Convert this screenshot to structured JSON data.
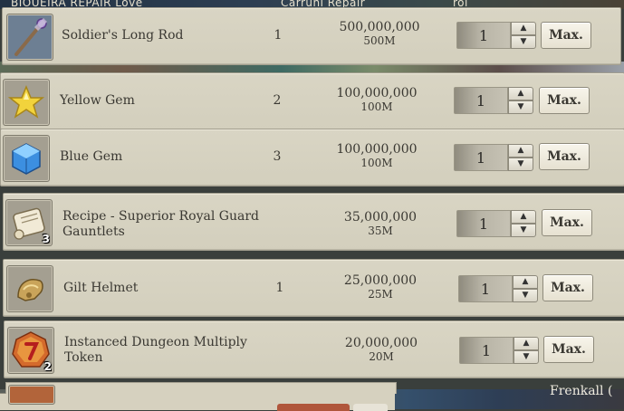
{
  "background": {
    "top_labels": [
      "BIOUEIRA REPAIR Love",
      "Carruni Repair",
      "roi"
    ],
    "side_name": "Frenkall ("
  },
  "max_label": "Max.",
  "items": [
    {
      "name": "Soldier's Long Rod",
      "count": "1",
      "price": "500,000,000",
      "price_short": "500M",
      "quantity": "1",
      "icon": "rod-icon",
      "badge": ""
    },
    {
      "name": "Yellow Gem",
      "count": "2",
      "price": "100,000,000",
      "price_short": "100M",
      "quantity": "1",
      "icon": "yellow-gem-icon",
      "badge": ""
    },
    {
      "name": "Blue Gem",
      "count": "3",
      "price": "100,000,000",
      "price_short": "100M",
      "quantity": "1",
      "icon": "blue-gem-icon",
      "badge": ""
    },
    {
      "name": "Recipe - Superior Royal Guard Gauntlets",
      "count": "",
      "price": "35,000,000",
      "price_short": "35M",
      "quantity": "1",
      "icon": "recipe-scroll-icon",
      "badge": "3"
    },
    {
      "name": "Gilt Helmet",
      "count": "1",
      "price": "25,000,000",
      "price_short": "25M",
      "quantity": "1",
      "icon": "helmet-icon",
      "badge": ""
    },
    {
      "name": "Instanced Dungeon Multiply Token",
      "count": "",
      "price": "20,000,000",
      "price_short": "20M",
      "quantity": "1",
      "icon": "dungeon-token-icon",
      "badge": "2"
    }
  ]
}
